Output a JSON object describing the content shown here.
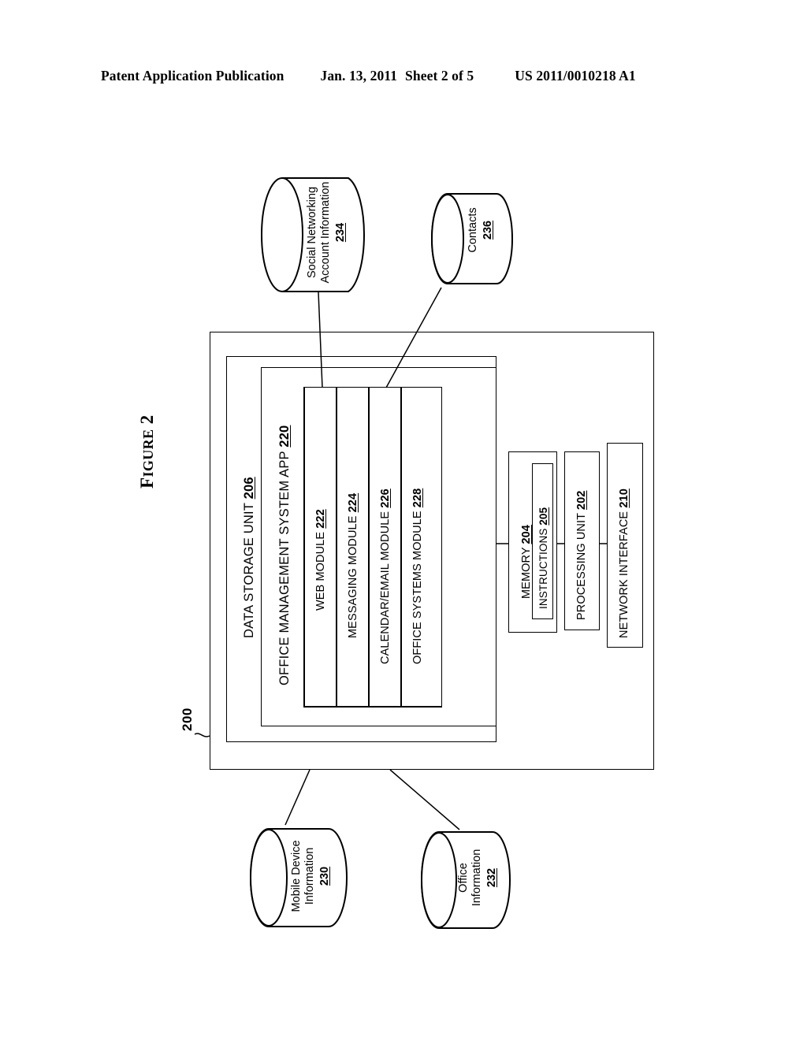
{
  "header": {
    "title": "Patent Application Publication",
    "date": "Jan. 13, 2011",
    "sheet": "Sheet 2 of 5",
    "publication_number": "US 2011/0010218 A1"
  },
  "figure": {
    "label_prefix": "F",
    "label_rest": "IGURE",
    "label_number": "2",
    "system_reference_numeral": "200"
  },
  "containers": {
    "data_storage_unit": {
      "label": "DATA STORAGE UNIT",
      "numeral": "206"
    },
    "office_management_app": {
      "label": "OFFICE MANAGEMENT SYSTEM APP",
      "numeral": "220"
    }
  },
  "modules": [
    {
      "label": "WEB MODULE",
      "numeral": "222"
    },
    {
      "label": "MESSAGING MODULE",
      "numeral": "224"
    },
    {
      "label": "CALENDAR/EMAIL MODULE",
      "numeral": "226"
    },
    {
      "label": "OFFICE SYSTEMS MODULE",
      "numeral": "228"
    }
  ],
  "hardware": [
    {
      "label": "MEMORY",
      "numeral": "204"
    },
    {
      "label": "PROCESSING UNIT",
      "numeral": "202"
    },
    {
      "label": "NETWORK INTERFACE",
      "numeral": "210"
    }
  ],
  "instructions": {
    "label": "INSTRUCTIONS",
    "numeral": "205"
  },
  "datastores": [
    {
      "id": "social-networking-account-information",
      "line1": "Social Networking",
      "line2": "Account Information",
      "numeral": "234"
    },
    {
      "id": "contacts",
      "line1": "Contacts",
      "line2": "",
      "numeral": "236"
    },
    {
      "id": "mobile-device-information",
      "line1": "Mobile Device",
      "line2": "Information",
      "numeral": "230"
    },
    {
      "id": "office-information",
      "line1": "Office",
      "line2": "Information",
      "numeral": "232"
    }
  ],
  "colors": {
    "ink": "#000000",
    "paper": "#ffffff"
  }
}
